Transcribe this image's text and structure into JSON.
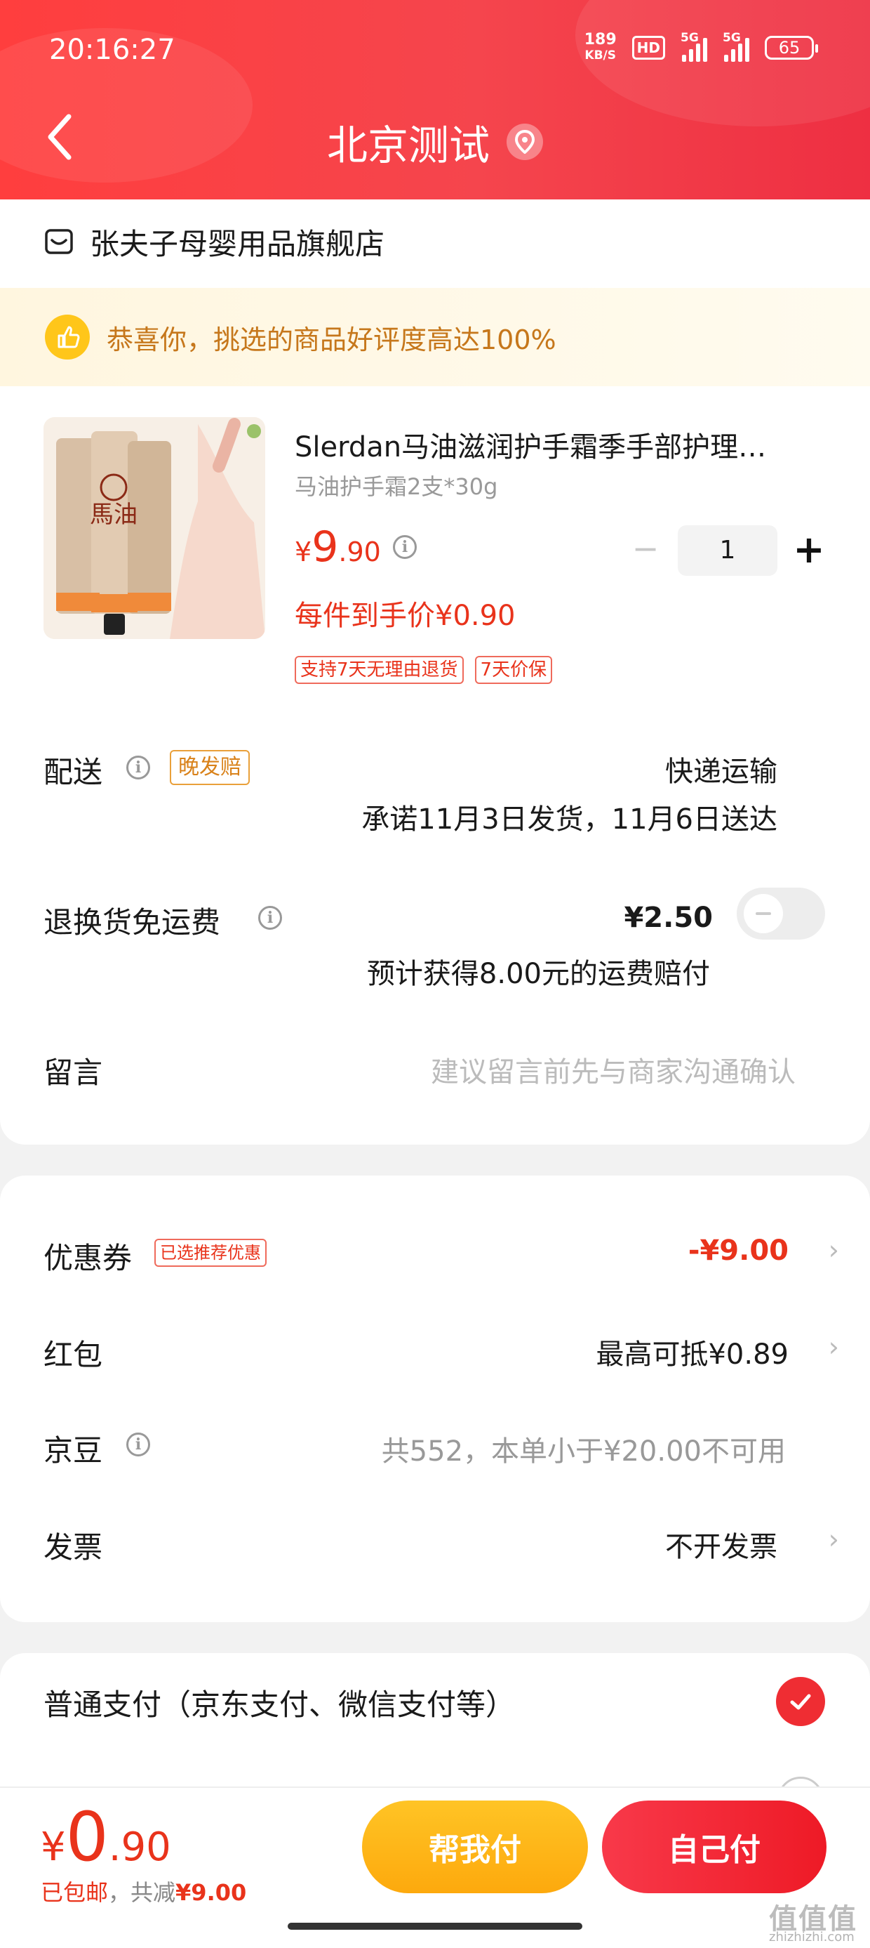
{
  "status_bar": {
    "time": "20:16:27",
    "speed_value": "189",
    "speed_unit": "KB/S",
    "hd": "HD",
    "sim1": "5G",
    "sim2": "5G",
    "battery": "65"
  },
  "header": {
    "title": "北京测试"
  },
  "shop": {
    "name": "张夫子母婴用品旗舰店"
  },
  "banner": {
    "text": "恭喜你，挑选的商品好评度高达100%"
  },
  "product": {
    "image_brand": "馬油",
    "title": "Slerdan马油滋润护手霜季手部护理…",
    "spec": "马油护手霜2支*30g",
    "price_symbol": "¥",
    "price_int": "9",
    "price_dec": ".90",
    "quantity": "1",
    "unit_price": "每件到手价¥0.90",
    "tags": [
      "支持7天无理由退货",
      "7天价保"
    ]
  },
  "delivery": {
    "label": "配送",
    "badge": "晚发赔",
    "method": "快递运输",
    "promise": "承诺11月3日发货，11月6日送达"
  },
  "return_shipping": {
    "label": "退换货免运费",
    "price": "¥2.50",
    "note": "预计获得8.00元的运费赔付",
    "enabled": false
  },
  "message": {
    "label": "留言",
    "placeholder": "建议留言前先与商家沟通确认"
  },
  "coupon": {
    "label": "优惠券",
    "tag": "已选推荐优惠",
    "value": "-¥9.00"
  },
  "red_packet": {
    "label": "红包",
    "value": "最高可抵¥0.89"
  },
  "jd_beans": {
    "label": "京豆",
    "value": "共552，本单小于¥20.00不可用"
  },
  "invoice": {
    "label": "发票",
    "value": "不开发票"
  },
  "payment": {
    "label": "普通支付（京东支付、微信支付等）"
  },
  "bottom": {
    "total_symbol": "¥",
    "total_int": "0",
    "total_dec": ".90",
    "shipping": "已包邮",
    "saved_prefix": "，共减",
    "saved_amount": "¥9.00",
    "help_pay": "帮我付",
    "self_pay": "自己付"
  },
  "watermark": {
    "main": "值值值",
    "sub": "zhizhizhi.com"
  },
  "colors": {
    "accent": "#e9331b",
    "header": "#f5454d",
    "help_btn": "#fdb31a"
  }
}
